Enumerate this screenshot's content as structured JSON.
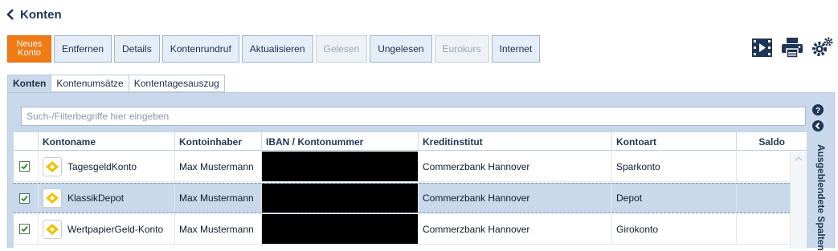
{
  "header": {
    "title": "Konten"
  },
  "toolbar": {
    "new_line1": "Neues",
    "new_line2": "Konto",
    "buttons": [
      "Entfernen",
      "Details",
      "Kontenrundruf",
      "Aktualisieren",
      "Gelesen",
      "Ungelesen",
      "Eurokurs",
      "Internet"
    ],
    "disabled": [
      "Gelesen",
      "Eurokurs"
    ]
  },
  "icons": {
    "video": "video-icon",
    "print": "printer-icon",
    "settings": "gears-icon"
  },
  "tabs": [
    "Konten",
    "Kontenumsätze",
    "Kontentagesauszug"
  ],
  "search": {
    "placeholder": "Such-/Filterbegriffe hier eingeben",
    "value": ""
  },
  "table": {
    "columns": [
      "Kontoname",
      "Kontoinhaber",
      "IBAN / Kontonummer",
      "Kreditinstitut",
      "Kontoart",
      "Saldo"
    ],
    "rows": [
      {
        "checked": true,
        "kontoname": "TagesgeldKonto",
        "inhaber": "Max Mustermann",
        "iban": "",
        "institut": "Commerzbank Hannover",
        "kontoart": "Sparkonto",
        "saldo": ""
      },
      {
        "checked": true,
        "kontoname": "KlassikDepot",
        "inhaber": "Max Mustermann",
        "iban": "",
        "institut": "Commerzbank Hannover",
        "kontoart": "Depot",
        "saldo": ""
      },
      {
        "checked": true,
        "kontoname": "WertpapierGeld-Konto",
        "inhaber": "Max Mustermann",
        "iban": "",
        "institut": "Commerzbank Hannover",
        "kontoart": "Girokonto",
        "saldo": ""
      }
    ],
    "selected_row": 1
  },
  "side_panel": {
    "label": "Ausgeblendete Spalten"
  },
  "colors": {
    "accent": "#f07a15",
    "panel": "#c9d8ea",
    "brand": "#1f3556",
    "logo": "#f2c200"
  }
}
